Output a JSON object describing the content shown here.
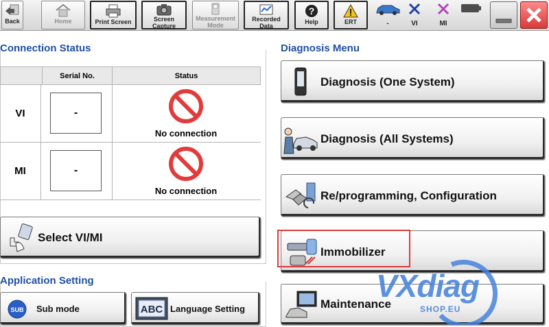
{
  "toolbar": {
    "back": "Back",
    "home": "Home",
    "print_screen": "Print Screen",
    "screen_capture_1": "Screen",
    "screen_capture_2": "Capture",
    "measurement_1": "Measurement",
    "measurement_2": "Mode",
    "recorded_1": "Recorded",
    "recorded_2": "Data",
    "help": "Help",
    "ert": "ERT",
    "vehicle_status": "-",
    "vi_status": "VI",
    "mi_status": "MI"
  },
  "connection_status": {
    "title": "Connection Status",
    "col_serial": "Serial No.",
    "col_status": "Status",
    "rows": [
      {
        "label": "VI",
        "serial": "-",
        "status": "No connection"
      },
      {
        "label": "MI",
        "serial": "-",
        "status": "No connection"
      }
    ]
  },
  "select_vimi": "Select VI/MI",
  "application_setting": {
    "title": "Application Setting",
    "sub_mode": "Sub mode",
    "sub_icon": "SUB",
    "language_setting": "Language Setting",
    "language_icon": "ABC"
  },
  "diagnosis_menu": {
    "title": "Diagnosis Menu",
    "items": [
      {
        "label": "Diagnosis (One System)"
      },
      {
        "label": "Diagnosis (All Systems)"
      },
      {
        "label": "Re/programming, Configuration"
      },
      {
        "label": "Immobilizer"
      },
      {
        "label": "Maintenance"
      }
    ]
  },
  "watermark": {
    "main": "VXdiag",
    "sub": "SHOP.EU"
  },
  "colors": {
    "section_title": "#1f4fa3",
    "no_connection": "#e23b3b",
    "highlight": "#e03838",
    "close": "#e04a4a",
    "watermark": "#4682dc"
  }
}
